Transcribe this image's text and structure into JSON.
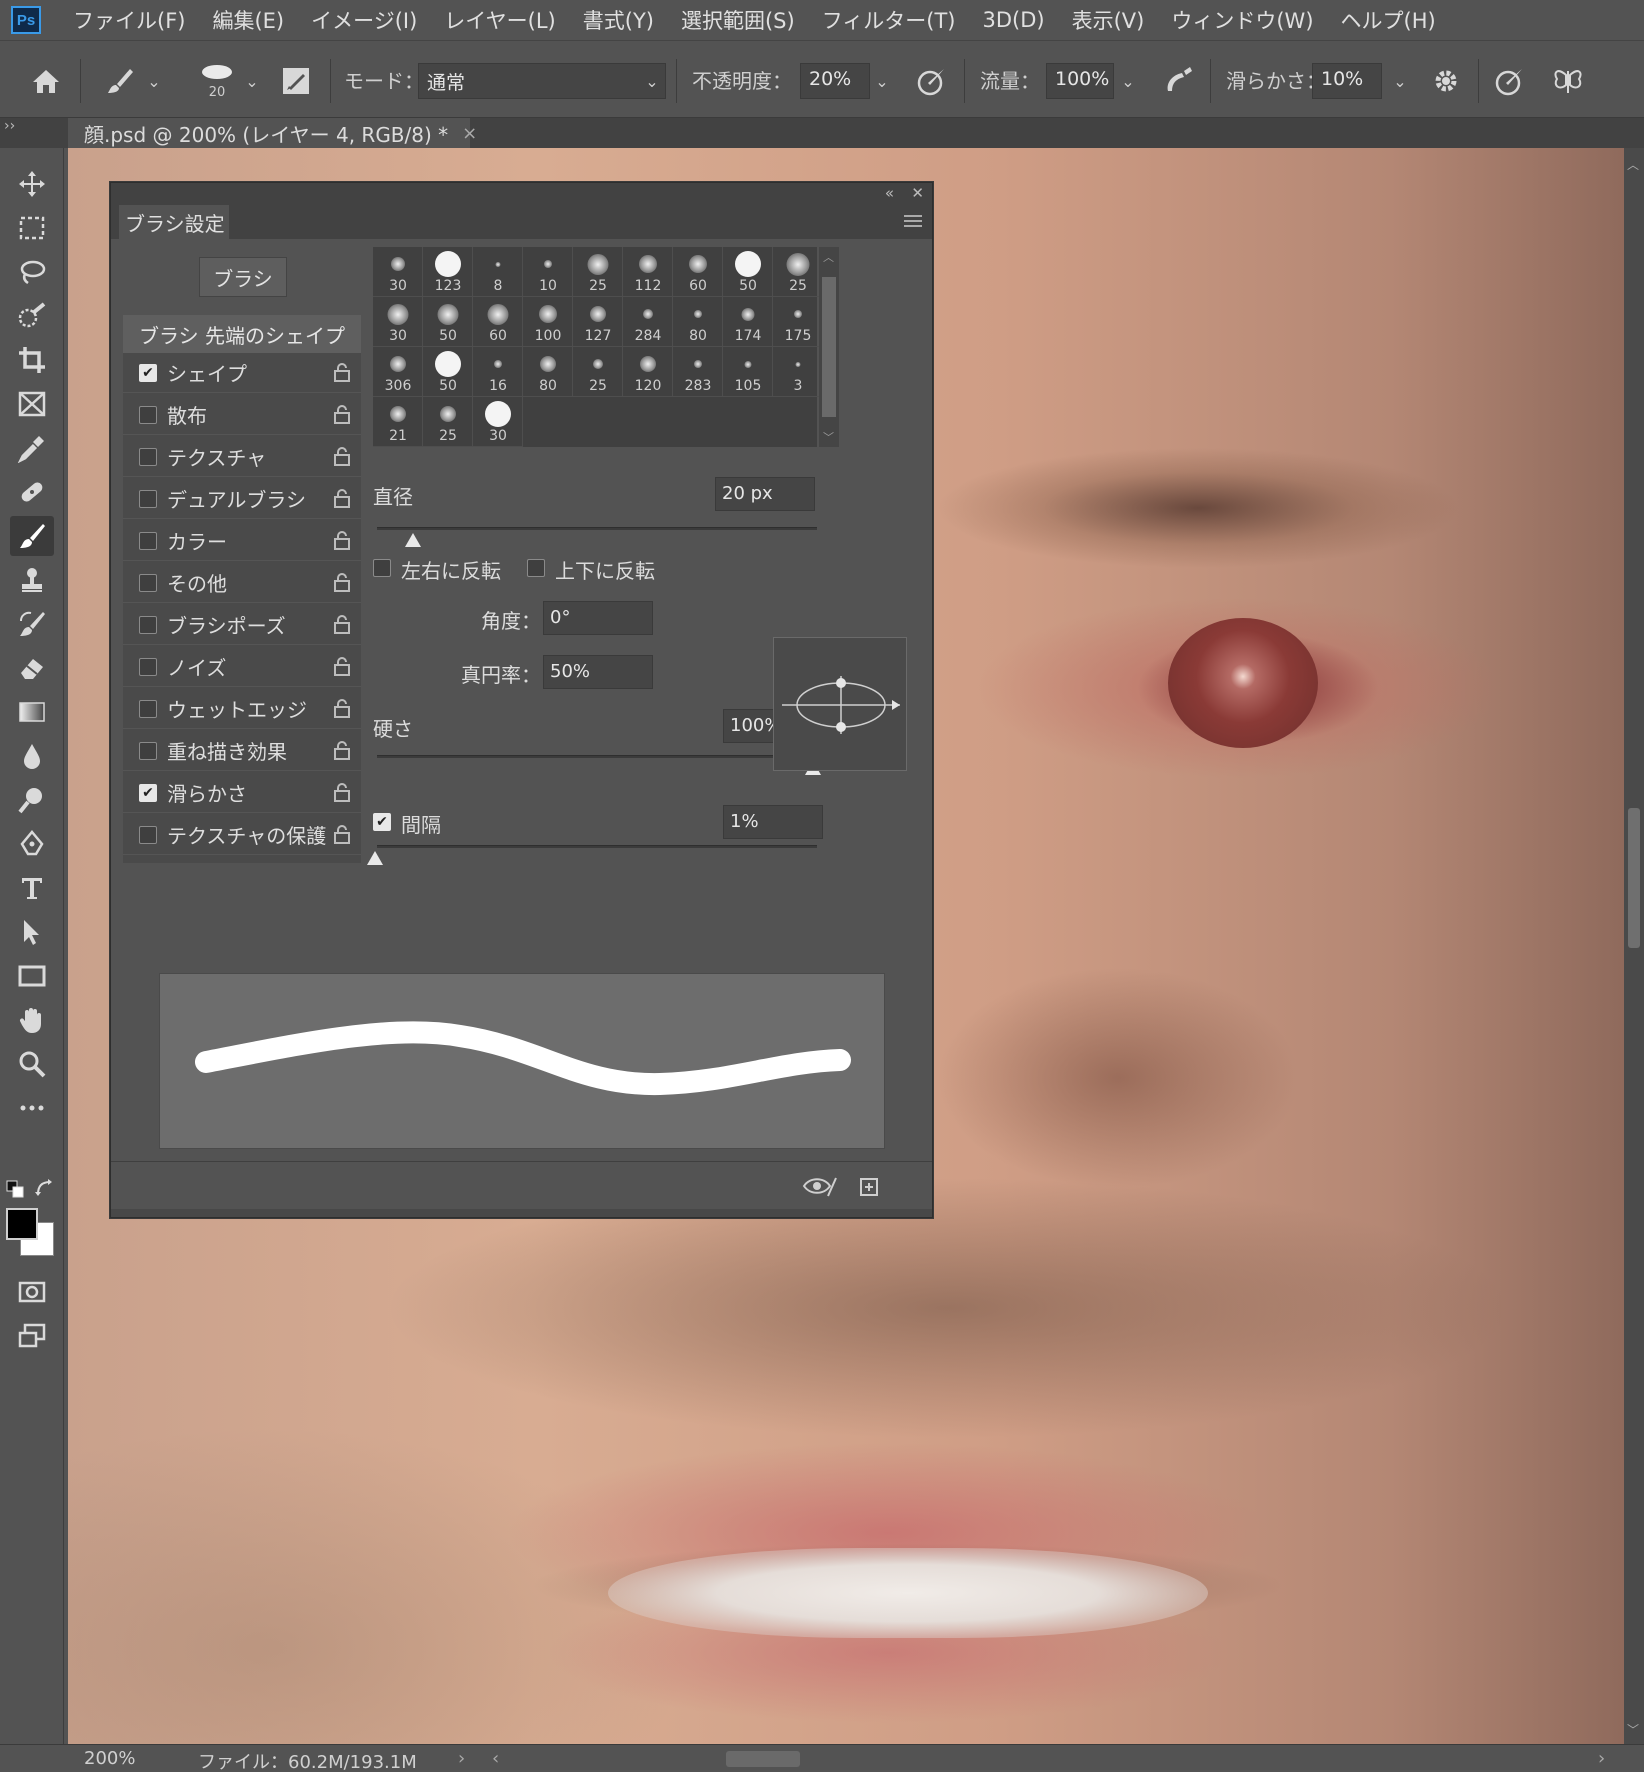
{
  "menubar": {
    "logo": "Ps",
    "items": [
      "ファイル(F)",
      "編集(E)",
      "イメージ(I)",
      "レイヤー(L)",
      "書式(Y)",
      "選択範囲(S)",
      "フィルター(T)",
      "3D(D)",
      "表示(V)",
      "ウィンドウ(W)",
      "ヘルプ(H)"
    ]
  },
  "options": {
    "brush_size": "20",
    "mode_label": "モード：",
    "mode_value": "通常",
    "opacity_label": "不透明度：",
    "opacity_value": "20%",
    "flow_label": "流量：",
    "flow_value": "100%",
    "smoothing_label": "滑らかさ：",
    "smoothing_value": "10%"
  },
  "document_tab": {
    "title": "顔.psd @ 200% (レイヤー 4, RGB/8) *",
    "close": "×"
  },
  "brush_panel": {
    "tab_label": "ブラシ設定",
    "brushes_button": "ブラシ",
    "tip_shape_label": "ブラシ 先端のシェイプ",
    "options": [
      {
        "label": "シェイプ",
        "checked": true
      },
      {
        "label": "散布",
        "checked": false
      },
      {
        "label": "テクスチャ",
        "checked": false
      },
      {
        "label": "デュアルブラシ",
        "checked": false
      },
      {
        "label": "カラー",
        "checked": false
      },
      {
        "label": "その他",
        "checked": false
      },
      {
        "label": "ブラシポーズ",
        "checked": false
      },
      {
        "label": "ノイズ",
        "checked": false
      },
      {
        "label": "ウェットエッジ",
        "checked": false
      },
      {
        "label": "重ね描き効果",
        "checked": false
      },
      {
        "label": "滑らかさ",
        "checked": true
      },
      {
        "label": "テクスチャの保護",
        "checked": false
      }
    ],
    "presets": [
      "30",
      "123",
      "8",
      "10",
      "25",
      "112",
      "60",
      "50",
      "25",
      "30",
      "50",
      "60",
      "100",
      "127",
      "284",
      "80",
      "174",
      "175",
      "306",
      "50",
      "16",
      "80",
      "25",
      "120",
      "283",
      "105",
      "3",
      "21",
      "25",
      "30"
    ],
    "diameter_label": "直径",
    "diameter_value": "20 px",
    "flip_x_label": "左右に反転",
    "flip_y_label": "上下に反転",
    "angle_label": "角度：",
    "angle_value": "0°",
    "roundness_label": "真円率：",
    "roundness_value": "50%",
    "hardness_label": "硬さ",
    "hardness_value": "100%",
    "spacing_label": "間隔",
    "spacing_value": "1%",
    "spacing_checked": true,
    "check_mark": "✔"
  },
  "statusbar": {
    "zoom": "200%",
    "file_info": "ファイル：60.2M/193.1M",
    "next": "›",
    "prev": "‹"
  },
  "colors": {
    "ui_bg": "#535353",
    "ui_dark": "#424242",
    "foreground": "#000000",
    "background": "#ffffff"
  },
  "icons": [
    "home-icon",
    "brush-icon",
    "brush-preset-icon",
    "toggle-panel-icon",
    "airbrush-icon",
    "pressure-icon",
    "settings-icon",
    "symmetry-icon"
  ]
}
